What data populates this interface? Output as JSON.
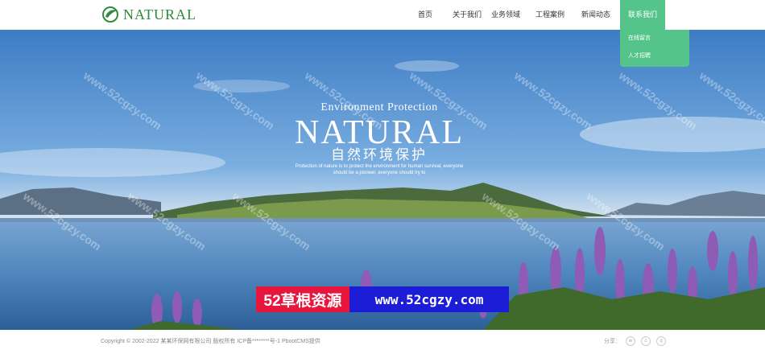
{
  "header": {
    "logo_text": "NATURAL",
    "nav": [
      {
        "label": "首页"
      },
      {
        "label": "关于我们"
      },
      {
        "label": "业务领域"
      },
      {
        "label": "工程案例"
      },
      {
        "label": "新闻动态"
      },
      {
        "label": "联系我们"
      }
    ],
    "active_submenu": [
      "在线留言",
      "人才招聘"
    ]
  },
  "hero": {
    "eyebrow": "Environment Protection",
    "title": "NATURAL",
    "cn_title": "自然环境保护",
    "desc_line1": "Protection of nature is to protect the environment for human survival, everyone",
    "desc_line2": "should be a pioneer, everyone should try to"
  },
  "watermark": "www.52cgzy.com",
  "banner": {
    "left": "52草根资源",
    "right": "www.52cgzy.com"
  },
  "footer": {
    "copyright": "Copyright © 2002-2022 某某环保网有限公司 版权所有  ICP备********号-1 PbootCMS提供",
    "share_label": "分享：",
    "share_icons": [
      "weibo-icon",
      "wechat-icon",
      "qq-icon"
    ]
  },
  "colors": {
    "accent": "#55c48a",
    "logo": "#2e8b3a",
    "banner_red": "#e8163d",
    "banner_blue": "#1d1dd8"
  }
}
